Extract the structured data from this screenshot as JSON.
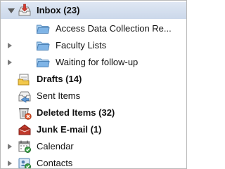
{
  "folders": [
    {
      "label": "Inbox (23)",
      "icon": "inbox-icon",
      "bold": true,
      "selected": true,
      "expanded": true
    },
    {
      "label": "Access Data Collection Re...",
      "icon": "folder-icon",
      "bold": false
    },
    {
      "label": "Faculty Lists",
      "icon": "folder-icon",
      "bold": false,
      "expandable": true
    },
    {
      "label": "Waiting for follow-up",
      "icon": "folder-icon",
      "bold": false,
      "expandable": true
    },
    {
      "label": "Drafts (14)",
      "icon": "drafts-icon",
      "bold": true
    },
    {
      "label": "Sent Items",
      "icon": "sent-items-icon",
      "bold": false
    },
    {
      "label": "Deleted Items (32)",
      "icon": "deleted-items-icon",
      "bold": true
    },
    {
      "label": "Junk E-mail (1)",
      "icon": "junk-email-icon",
      "bold": true
    },
    {
      "label": "Calendar",
      "icon": "calendar-icon",
      "bold": false,
      "expandable": true
    },
    {
      "label": "Contacts",
      "icon": "contacts-icon",
      "bold": false,
      "expandable": true
    }
  ],
  "colors": {
    "selection": "#cbd8ea",
    "folder_blue": "#7fb4e6",
    "inbox_red": "#d63b2f"
  }
}
